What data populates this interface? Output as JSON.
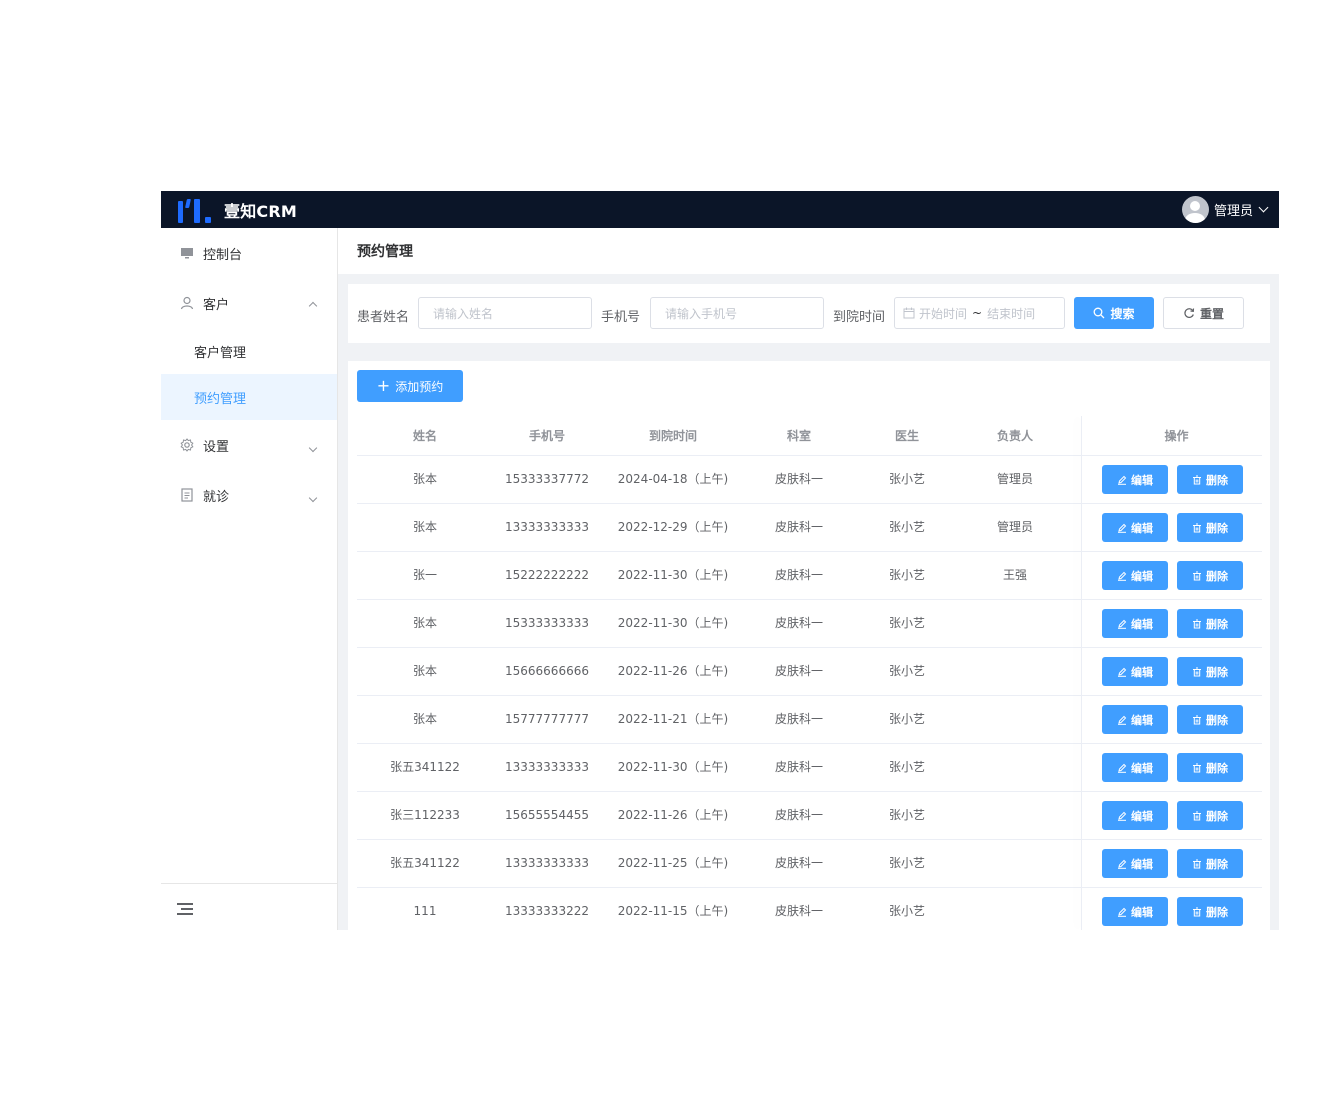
{
  "app": {
    "title": "壹知CRM"
  },
  "user": {
    "name": "管理员"
  },
  "sidebar": {
    "items": [
      {
        "label": "控制台",
        "icon": "monitor-icon"
      },
      {
        "label": "客户",
        "icon": "user-icon",
        "expanded": true,
        "children": [
          {
            "label": "客户管理"
          },
          {
            "label": "预约管理",
            "active": true
          }
        ]
      },
      {
        "label": "设置",
        "icon": "gear-icon"
      },
      {
        "label": "就诊",
        "icon": "document-icon"
      }
    ]
  },
  "page": {
    "title": "预约管理"
  },
  "filters": {
    "name_label": "患者姓名",
    "name_placeholder": "请输入姓名",
    "phone_label": "手机号",
    "phone_placeholder": "请输入手机号",
    "date_label": "到院时间",
    "date_start_placeholder": "开始时间",
    "date_sep": "~",
    "date_end_placeholder": "结束时间",
    "search_label": "搜索",
    "reset_label": "重置"
  },
  "toolbar": {
    "add_label": "添加预约"
  },
  "table": {
    "columns": [
      "姓名",
      "手机号",
      "到院时间",
      "科室",
      "医生",
      "负责人",
      "操作"
    ],
    "edit_label": "编辑",
    "delete_label": "删除",
    "rows": [
      {
        "name": "张本",
        "phone": "15333337772",
        "time": "2024-04-18（上午)",
        "dept": "皮肤科一",
        "doctor": "张小艺",
        "owner": "管理员"
      },
      {
        "name": "张本",
        "phone": "13333333333",
        "time": "2022-12-29（上午)",
        "dept": "皮肤科一",
        "doctor": "张小艺",
        "owner": "管理员"
      },
      {
        "name": "张一",
        "phone": "15222222222",
        "time": "2022-11-30（上午)",
        "dept": "皮肤科一",
        "doctor": "张小艺",
        "owner": "王强"
      },
      {
        "name": "张本",
        "phone": "15333333333",
        "time": "2022-11-30（上午)",
        "dept": "皮肤科一",
        "doctor": "张小艺",
        "owner": ""
      },
      {
        "name": "张本",
        "phone": "15666666666",
        "time": "2022-11-26（上午)",
        "dept": "皮肤科一",
        "doctor": "张小艺",
        "owner": ""
      },
      {
        "name": "张本",
        "phone": "15777777777",
        "time": "2022-11-21（上午)",
        "dept": "皮肤科一",
        "doctor": "张小艺",
        "owner": ""
      },
      {
        "name": "张五341122",
        "phone": "13333333333",
        "time": "2022-11-30（上午)",
        "dept": "皮肤科一",
        "doctor": "张小艺",
        "owner": ""
      },
      {
        "name": "张三112233",
        "phone": "15655554455",
        "time": "2022-11-26（上午)",
        "dept": "皮肤科一",
        "doctor": "张小艺",
        "owner": ""
      },
      {
        "name": "张五341122",
        "phone": "13333333333",
        "time": "2022-11-25（上午)",
        "dept": "皮肤科一",
        "doctor": "张小艺",
        "owner": ""
      },
      {
        "name": "111",
        "phone": "13333333222",
        "time": "2022-11-15（上午)",
        "dept": "皮肤科一",
        "doctor": "张小艺",
        "owner": ""
      }
    ]
  },
  "colors": {
    "primary": "#409eff",
    "header_bg": "#0b1528",
    "logo_blue": "#1e6bff",
    "active_bg": "#ecf5ff"
  }
}
